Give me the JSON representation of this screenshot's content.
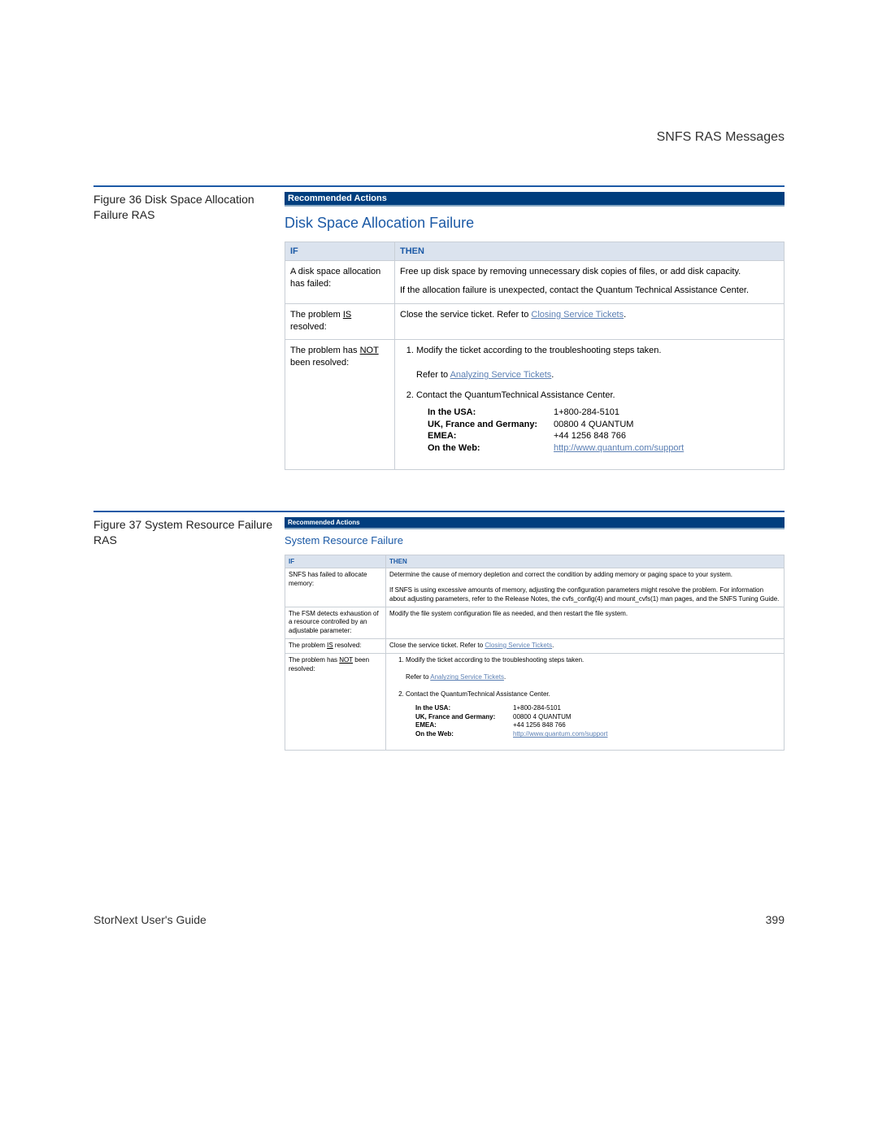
{
  "running_head": "SNFS RAS Messages",
  "footer": {
    "left": "StorNext User's Guide",
    "right": "399"
  },
  "shared": {
    "rec_bar": "Recommended Actions",
    "th_if": "IF",
    "th_then": "THEN",
    "contacts": {
      "usa_label": "In the USA:",
      "usa_val": "1+800-284-5101",
      "eu_label": "UK, France and Germany:",
      "eu_val": "00800 4 QUANTUM",
      "emea_label": "EMEA:",
      "emea_val": "+44 1256 848 766",
      "web_label": "On the Web:",
      "web_val": "http://www.quantum.com/support"
    },
    "step1": "Modify the ticket according to the troubleshooting steps taken.",
    "step1_ref_pre": "Refer to ",
    "step1_ref_link": "Analyzing Service Tickets",
    "step2": "Contact the QuantumTechnical Assistance Center.",
    "closing_pre": "Close the service ticket. Refer to ",
    "closing_link": "Closing Service Tickets"
  },
  "fig36": {
    "caption": "Figure 36  Disk Space Allocation Failure RAS",
    "title": "Disk Space Allocation Failure",
    "row1_if": "A disk space allocation has failed:",
    "row1_then_a": "Free up disk space by removing unnecessary disk copies of files, or add disk capacity.",
    "row1_then_b": "If the allocation failure is unexpected, contact the Quantum Technical Assistance Center.",
    "row2_if_pre": "The problem ",
    "row2_if_u": "IS",
    "row2_if_post": " resolved:",
    "row3_if_pre": "The problem has ",
    "row3_if_u": "NOT",
    "row3_if_post": " been resolved:"
  },
  "fig37": {
    "caption": "Figure 37  System Resource Failure RAS",
    "title": "System Resource Failure",
    "row1_if": "SNFS has failed to allocate memory:",
    "row1_then_a": "Determine the cause of memory depletion and correct the condition by adding memory or paging space to your system.",
    "row1_then_b": "If SNFS is using excessive amounts of memory, adjusting the configuration parameters might resolve the problem. For information about adjusting parameters, refer to the Release Notes, the cvfs_config(4) and mount_cvfs(1) man pages, and the SNFS Tuning Guide.",
    "row2_if": "The FSM detects exhaustion of a resource controlled by an adjustable parameter:",
    "row2_then": "Modify the file system configuration file as needed, and then restart the file system.",
    "row3_if_pre": "The problem ",
    "row3_if_u": "IS",
    "row3_if_post": " resolved:",
    "row4_if_pre": "The problem has ",
    "row4_if_u": "NOT",
    "row4_if_post": " been resolved:"
  }
}
